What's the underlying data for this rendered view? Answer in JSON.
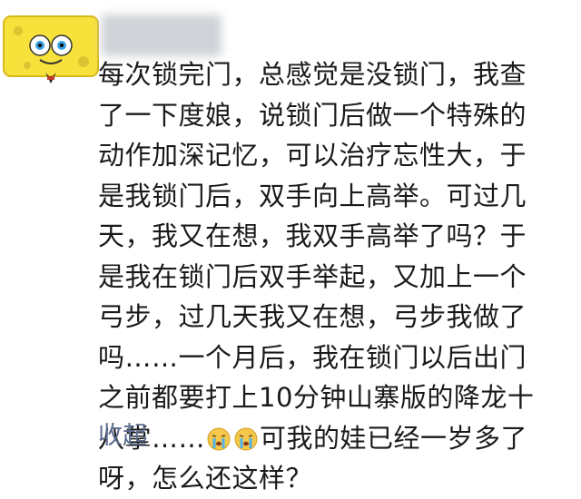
{
  "post": {
    "author_avatar": "spongebob-avatar",
    "text_part1": "每次锁完门，总感觉是没锁门，我查了一下度娘，说锁门后做一个特殊的动作加深记忆，可以治疗忘性大，于是我锁门后，双手向上高举。可过几天，我又在想，我双手高举了吗？于是我在锁门后双手举起，又加上一个弓步，过几天我又在想，弓步我做了吗……一个月后，我在锁门以后出门之前都要打上10分钟山寨版的降龙十八掌……",
    "emojis": [
      "crying-face-icon",
      "crying-face-icon"
    ],
    "text_part2": "可我的娃已经一岁多了呀，怎么还这样？",
    "collapse_label": "收起"
  }
}
